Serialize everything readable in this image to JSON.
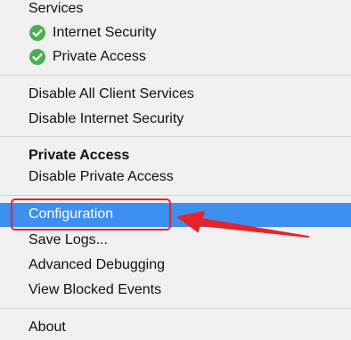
{
  "menu": {
    "services_header": "Services",
    "services": [
      {
        "label": "Internet Security",
        "icon": "green-check-icon"
      },
      {
        "label": "Private Access",
        "icon": "green-check-icon"
      }
    ],
    "disable_all": "Disable All Client Services",
    "disable_internet_security": "Disable Internet Security",
    "private_access_header": "Private Access",
    "disable_private_access": "Disable Private Access",
    "configuration": "Configuration",
    "save_logs": "Save Logs...",
    "advanced_debugging": "Advanced Debugging",
    "view_blocked_events": "View Blocked Events",
    "about": "About",
    "selected_item": "Configuration"
  },
  "colors": {
    "background": "#f0f0f0",
    "highlight": "#3d8ff0",
    "check": "#4caf50",
    "annotation": "#e8222a"
  }
}
